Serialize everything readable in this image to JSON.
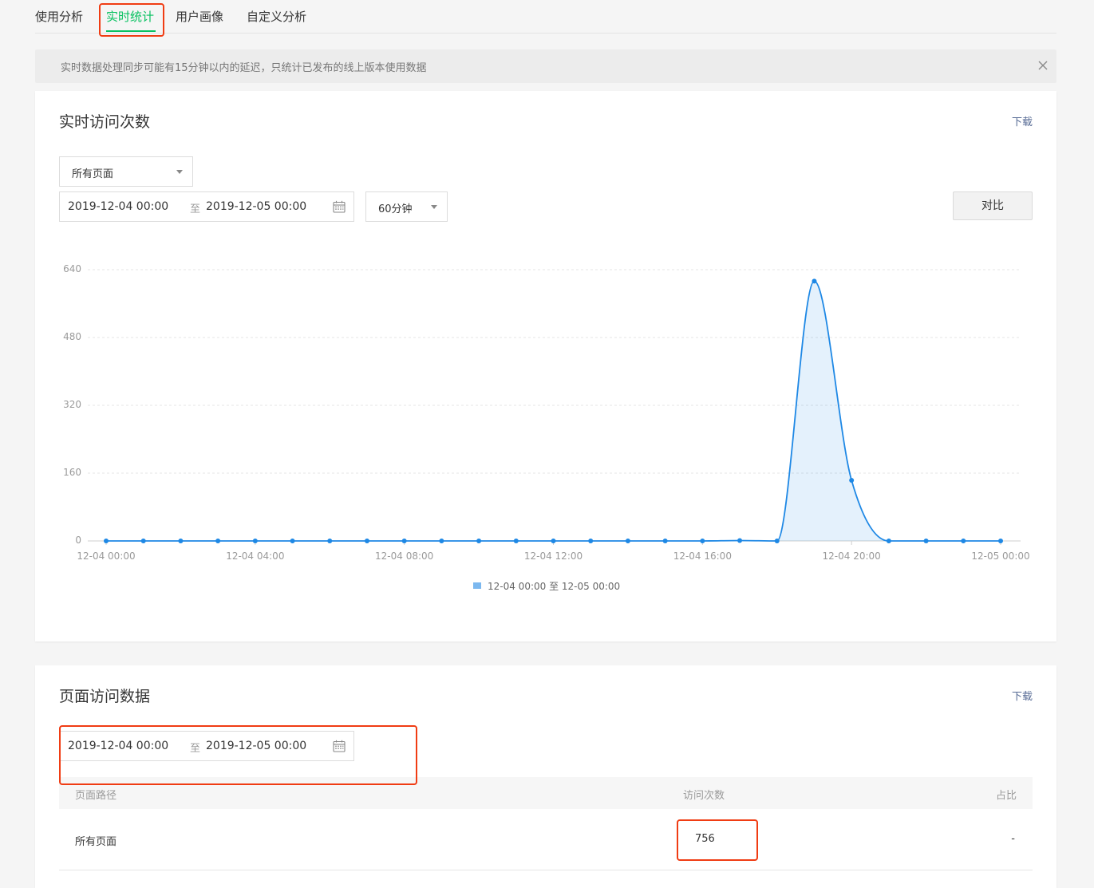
{
  "tabs": [
    {
      "label": "使用分析"
    },
    {
      "label": "实时统计",
      "active": true
    },
    {
      "label": "用户画像"
    },
    {
      "label": "自定义分析"
    }
  ],
  "notice": {
    "text": "实时数据处理同步可能有15分钟以内的延迟，只统计已发布的线上版本使用数据"
  },
  "realtime": {
    "title": "实时访问次数",
    "download": "下载",
    "page_select": "所有页面",
    "date_start": "2019-12-04 00:00",
    "date_sep": "至",
    "date_end": "2019-12-05 00:00",
    "interval_select": "60分钟",
    "compare_button": "对比"
  },
  "chart_data": {
    "type": "area",
    "x_tick_labels": [
      "12-04 00:00",
      "12-04 04:00",
      "12-04 08:00",
      "12-04 12:00",
      "12-04 16:00",
      "12-04 20:00",
      "12-05 00:00"
    ],
    "x": [
      "12-04 00:00",
      "12-04 01:00",
      "12-04 02:00",
      "12-04 03:00",
      "12-04 04:00",
      "12-04 05:00",
      "12-04 06:00",
      "12-04 07:00",
      "12-04 08:00",
      "12-04 09:00",
      "12-04 10:00",
      "12-04 11:00",
      "12-04 12:00",
      "12-04 13:00",
      "12-04 14:00",
      "12-04 15:00",
      "12-04 16:00",
      "12-04 17:00",
      "12-04 18:00",
      "12-04 19:00",
      "12-04 20:00",
      "12-04 21:00",
      "12-04 22:00",
      "12-04 23:00",
      "12-05 00:00"
    ],
    "series": [
      {
        "name": "12-04 00:00 至 12-05 00:00",
        "color": "#1e88e5",
        "values": [
          0,
          0,
          0,
          0,
          0,
          0,
          0,
          0,
          0,
          0,
          0,
          0,
          0,
          0,
          0,
          0,
          0,
          1,
          0,
          613,
          143,
          0,
          0,
          0,
          0
        ]
      }
    ],
    "y_ticks": [
      0,
      160,
      320,
      480,
      640
    ],
    "ylim": [
      0,
      640
    ],
    "grid": true,
    "legend": "bottom"
  },
  "pages": {
    "title": "页面访问数据",
    "download": "下载",
    "date_start": "2019-12-04 00:00",
    "date_sep": "至",
    "date_end": "2019-12-05 00:00",
    "columns": [
      "页面路径",
      "访问次数",
      "占比"
    ],
    "rows": [
      {
        "path": "所有页面",
        "visits": "756",
        "ratio": "-"
      }
    ]
  }
}
